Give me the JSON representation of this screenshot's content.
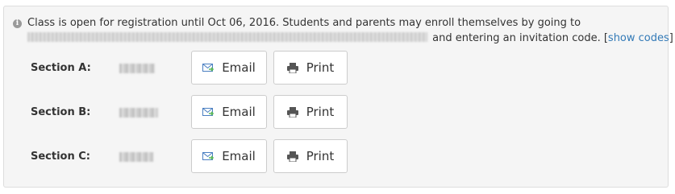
{
  "notice": {
    "text": "Class is open for registration until Oct 06, 2016. Students and parents may enroll themselves by going to",
    "text_after_url": " and entering an invitation code. ",
    "show_codes_label": "show codes",
    "bracket_open": "[",
    "bracket_close": "]"
  },
  "sections": [
    {
      "label": "Section A:",
      "email_label": "Email",
      "print_label": "Print"
    },
    {
      "label": "Section B:",
      "email_label": "Email",
      "print_label": "Print"
    },
    {
      "label": "Section C:",
      "email_label": "Email",
      "print_label": "Print"
    }
  ],
  "colors": {
    "link": "#337ab7",
    "panel_bg": "#f5f5f5",
    "email_icon_green": "#5cb85c",
    "email_icon_blue": "#4a7fc1"
  },
  "icons": {
    "info": "info-circle-icon",
    "email": "email-envelope-icon",
    "print": "printer-icon"
  }
}
